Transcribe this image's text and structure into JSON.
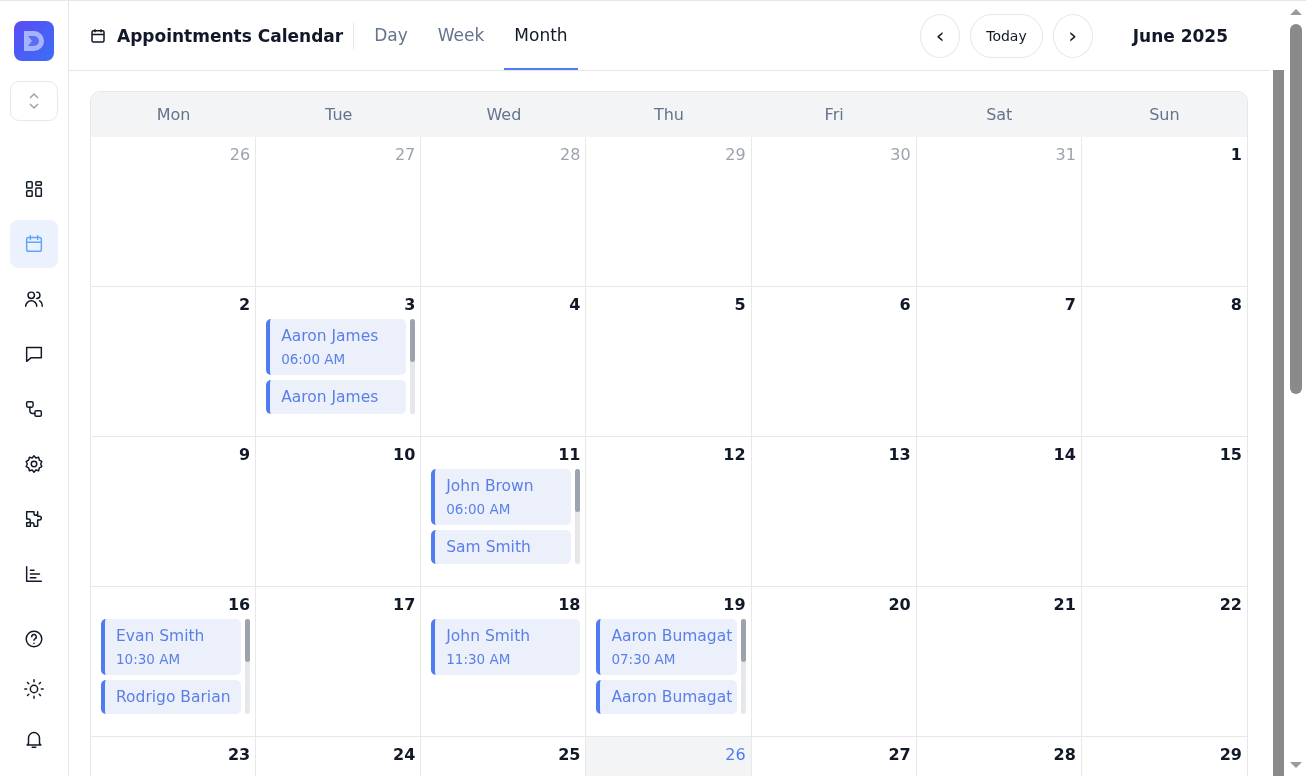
{
  "header": {
    "title": "Appointments Calendar",
    "tabs": [
      {
        "label": "Day",
        "selected": false
      },
      {
        "label": "Week",
        "selected": false
      },
      {
        "label": "Month",
        "selected": true
      }
    ],
    "prev": "‹",
    "today": "Today",
    "next": "›",
    "period": "June 2025"
  },
  "sidebar": {
    "items": [
      {
        "selected": false
      },
      {
        "selected": true
      },
      {
        "selected": false
      },
      {
        "selected": false
      },
      {
        "selected": false
      },
      {
        "selected": false
      },
      {
        "selected": false
      },
      {
        "selected": false
      }
    ],
    "bottom_items": [
      {
        "selected": false
      },
      {
        "selected": false
      },
      {
        "selected": false
      }
    ]
  },
  "calendar": {
    "weekdays": [
      "Mon",
      "Tue",
      "Wed",
      "Thu",
      "Fri",
      "Sat",
      "Sun"
    ],
    "days": [
      {
        "day": "26",
        "muted": true,
        "today": false
      },
      {
        "day": "27",
        "muted": true,
        "today": false
      },
      {
        "day": "28",
        "muted": true,
        "today": false
      },
      {
        "day": "29",
        "muted": true,
        "today": false
      },
      {
        "day": "30",
        "muted": true,
        "today": false
      },
      {
        "day": "31",
        "muted": true,
        "today": false
      },
      {
        "day": "1",
        "muted": false,
        "today": false
      },
      {
        "day": "2",
        "muted": false,
        "today": false
      },
      {
        "day": "3",
        "muted": false,
        "today": false,
        "events": [
          {
            "name": "Aaron James",
            "time": "06:00 AM"
          },
          {
            "name": "Aaron James"
          }
        ]
      },
      {
        "day": "4",
        "muted": false,
        "today": false
      },
      {
        "day": "5",
        "muted": false,
        "today": false
      },
      {
        "day": "6",
        "muted": false,
        "today": false
      },
      {
        "day": "7",
        "muted": false,
        "today": false
      },
      {
        "day": "8",
        "muted": false,
        "today": false
      },
      {
        "day": "9",
        "muted": false,
        "today": false
      },
      {
        "day": "10",
        "muted": false,
        "today": false
      },
      {
        "day": "11",
        "muted": false,
        "today": false,
        "events": [
          {
            "name": "John Brown",
            "time": "06:00 AM"
          },
          {
            "name": "Sam Smith"
          }
        ]
      },
      {
        "day": "12",
        "muted": false,
        "today": false
      },
      {
        "day": "13",
        "muted": false,
        "today": false
      },
      {
        "day": "14",
        "muted": false,
        "today": false
      },
      {
        "day": "15",
        "muted": false,
        "today": false
      },
      {
        "day": "16",
        "muted": false,
        "today": false,
        "events": [
          {
            "name": "Evan Smith",
            "time": "10:30 AM"
          },
          {
            "name": "Rodrigo Barian"
          }
        ]
      },
      {
        "day": "17",
        "muted": false,
        "today": false
      },
      {
        "day": "18",
        "muted": false,
        "today": false,
        "events": [
          {
            "name": "John Smith",
            "time": "11:30 AM"
          }
        ]
      },
      {
        "day": "19",
        "muted": false,
        "today": false,
        "events": [
          {
            "name": "Aaron Bumagat",
            "time": "07:30 AM"
          },
          {
            "name": "Aaron Bumagat"
          }
        ]
      },
      {
        "day": "20",
        "muted": false,
        "today": false
      },
      {
        "day": "21",
        "muted": false,
        "today": false
      },
      {
        "day": "22",
        "muted": false,
        "today": false
      },
      {
        "day": "23",
        "muted": false,
        "today": false
      },
      {
        "day": "24",
        "muted": false,
        "today": false
      },
      {
        "day": "25",
        "muted": false,
        "today": false
      },
      {
        "day": "26",
        "muted": false,
        "today": true
      },
      {
        "day": "27",
        "muted": false,
        "today": false
      },
      {
        "day": "28",
        "muted": false,
        "today": false
      },
      {
        "day": "29",
        "muted": false,
        "today": false
      }
    ]
  }
}
